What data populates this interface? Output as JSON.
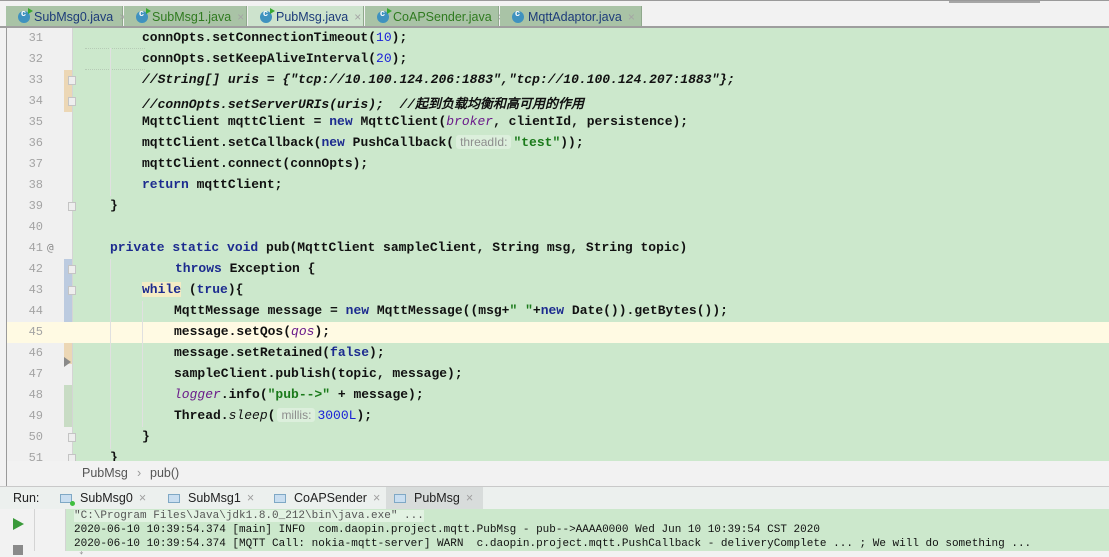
{
  "editor_tabs": [
    {
      "label": "SubMsg0.java",
      "icon": "java-class-run-icon",
      "color": "blue",
      "active": false
    },
    {
      "label": "SubMsg1.java",
      "icon": "java-class-run-icon",
      "color": "green",
      "active": false
    },
    {
      "label": "PubMsg.java",
      "icon": "java-class-run-icon",
      "color": "blue",
      "active": true
    },
    {
      "label": "CoAPSender.java",
      "icon": "java-class-run-icon",
      "color": "green",
      "active": false
    },
    {
      "label": "MqttAdaptor.java",
      "icon": "java-class-icon",
      "color": "blue",
      "active": false
    }
  ],
  "tab_close_glyph": "×",
  "code_lines": [
    {
      "num": "31",
      "text": "connOpts.setConnectionTimeout(10);"
    },
    {
      "num": "32",
      "text": "connOpts.setKeepAliveInterval(20);"
    },
    {
      "num": "33",
      "text": "//String[] uris = {\"tcp://10.100.124.206:1883\",\"tcp://10.100.124.207:1883\"};"
    },
    {
      "num": "34",
      "text": "//connOpts.setServerURIs(uris);  //起到负载均衡和高可用的作用"
    },
    {
      "num": "35",
      "text": "MqttClient mqttClient = new MqttClient(broker, clientId, persistence);"
    },
    {
      "num": "36",
      "text": "mqttClient.setCallback(new PushCallback( threadId: \"test\"));"
    },
    {
      "num": "37",
      "text": "mqttClient.connect(connOpts);"
    },
    {
      "num": "38",
      "text": "return mqttClient;"
    },
    {
      "num": "39",
      "text": "}"
    },
    {
      "num": "40",
      "text": ""
    },
    {
      "num": "41",
      "text": "private static void pub(MqttClient sampleClient, String msg, String topic)",
      "marker": "@"
    },
    {
      "num": "42",
      "text": "throws Exception {"
    },
    {
      "num": "43",
      "text": "while (true){"
    },
    {
      "num": "44",
      "text": "MqttMessage message = new MqttMessage((msg+\" \"+new Date()).getBytes());"
    },
    {
      "num": "45",
      "text": "message.setQos(qos);"
    },
    {
      "num": "46",
      "text": "message.setRetained(false);"
    },
    {
      "num": "47",
      "text": "sampleClient.publish(topic, message);"
    },
    {
      "num": "48",
      "text": "logger.info(\"pub-->\" + message);"
    },
    {
      "num": "49",
      "text": "Thread.sleep( millis: 3000L);"
    },
    {
      "num": "50",
      "text": "}"
    },
    {
      "num": "51",
      "text": "}"
    }
  ],
  "param_hints": {
    "thread_id": "threadId:",
    "millis": "millis:"
  },
  "breadcrumb": {
    "class": "PubMsg",
    "separator": "›",
    "method": "pub()"
  },
  "run_panel": {
    "label": "Run:",
    "tabs": [
      {
        "label": "SubMsg0",
        "running": true,
        "active": false
      },
      {
        "label": "SubMsg1",
        "running": false,
        "active": false
      },
      {
        "label": "CoAPSender",
        "running": false,
        "active": false
      },
      {
        "label": "PubMsg",
        "running": false,
        "active": true
      }
    ],
    "console_lines": [
      "\"C:\\Program Files\\Java\\jdk1.8.0_212\\bin\\java.exe\" ...",
      "2020-06-10 10:39:54.374 [main] INFO  com.daopin.project.mqtt.PubMsg - pub-->AAAA0000 Wed Jun 10 10:39:54 CST 2020",
      "2020-06-10 10:39:54.374 [MQTT Call: nokia-mqtt-server] WARN  c.daopin.project.mqtt.PushCallback - deliveryComplete ... ; We will do something ..."
    ]
  },
  "colors": {
    "editor_bg": "#cce8cc",
    "caret_line": "#fffae3",
    "keyword": "#1c2b8f",
    "string": "#1a7a1a",
    "number": "#1a22d8",
    "comment": "#8a8a8a",
    "field": "#6a1a8a"
  }
}
